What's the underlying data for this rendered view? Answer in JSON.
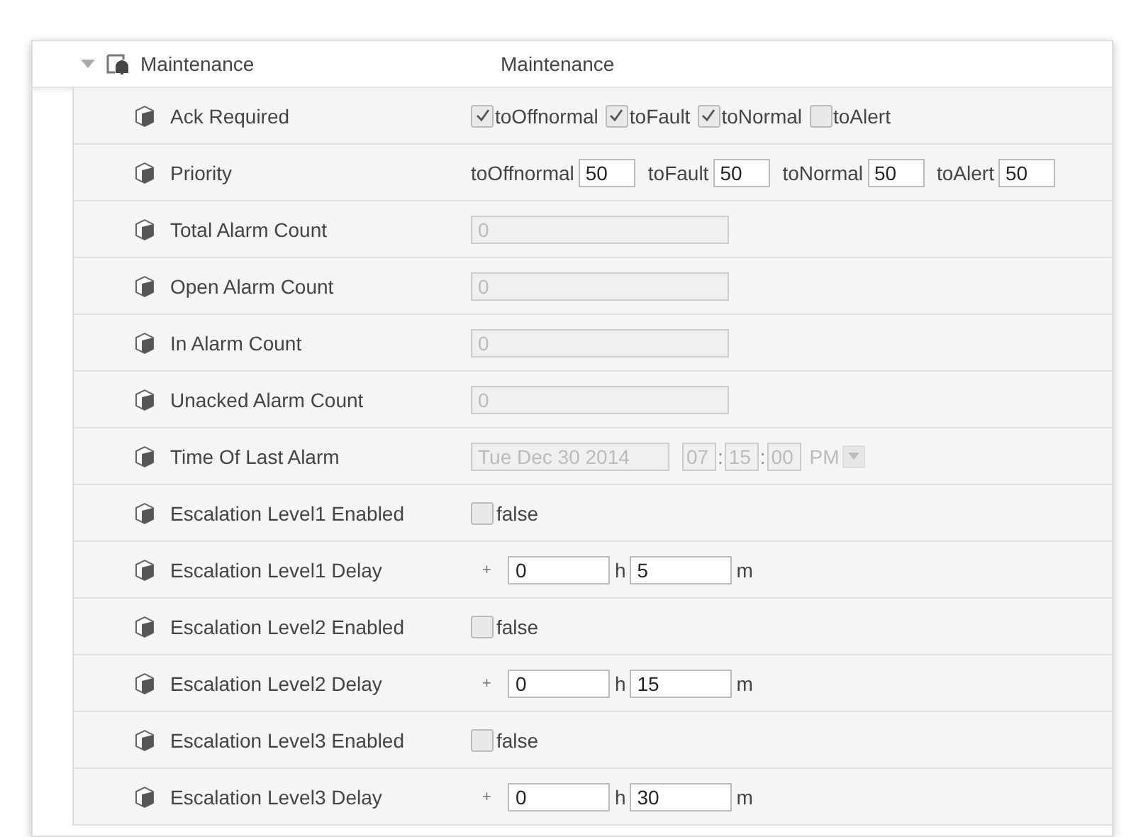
{
  "header": {
    "expanded": true,
    "name": "Maintenance",
    "value": "Maintenance"
  },
  "rows": [
    {
      "kind": "checks",
      "label": "Ack Required",
      "options": [
        {
          "label": "toOffnormal",
          "checked": true
        },
        {
          "label": "toFault",
          "checked": true
        },
        {
          "label": "toNormal",
          "checked": true
        },
        {
          "label": "toAlert",
          "checked": false
        }
      ]
    },
    {
      "kind": "fields",
      "label": "Priority",
      "fields": [
        {
          "label": "toOffnormal",
          "value": "50"
        },
        {
          "label": "toFault",
          "value": "50"
        },
        {
          "label": "toNormal",
          "value": "50"
        },
        {
          "label": "toAlert",
          "value": "50"
        }
      ]
    },
    {
      "kind": "readonly",
      "label": "Total Alarm Count",
      "value": "0"
    },
    {
      "kind": "readonly",
      "label": "Open Alarm Count",
      "value": "0"
    },
    {
      "kind": "readonly",
      "label": "In Alarm Count",
      "value": "0"
    },
    {
      "kind": "readonly",
      "label": "Unacked Alarm Count",
      "value": "0"
    },
    {
      "kind": "datetime",
      "label": "Time Of Last Alarm",
      "date": "Tue Dec 30 2014",
      "hour": "07",
      "minute": "15",
      "second": "00",
      "separators": [
        ":",
        ":"
      ],
      "ampm": "PM"
    },
    {
      "kind": "bool",
      "label": "Escalation Level1 Enabled",
      "checked": false,
      "text": "false"
    },
    {
      "kind": "duration",
      "label": "Escalation Level1 Delay",
      "sign": "+",
      "hours": "0",
      "hour_unit": "h",
      "minutes": "5",
      "minute_unit": "m"
    },
    {
      "kind": "bool",
      "label": "Escalation Level2 Enabled",
      "checked": false,
      "text": "false"
    },
    {
      "kind": "duration",
      "label": "Escalation Level2 Delay",
      "sign": "+",
      "hours": "0",
      "hour_unit": "h",
      "minutes": "15",
      "minute_unit": "m"
    },
    {
      "kind": "bool",
      "label": "Escalation Level3 Enabled",
      "checked": false,
      "text": "false"
    },
    {
      "kind": "duration",
      "label": "Escalation Level3 Delay",
      "sign": "+",
      "hours": "0",
      "hour_unit": "h",
      "minutes": "30",
      "minute_unit": "m"
    }
  ]
}
